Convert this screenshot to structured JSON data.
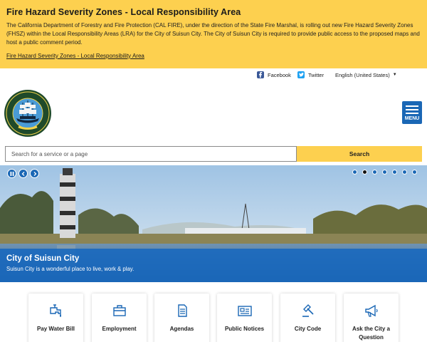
{
  "alert": {
    "title": "Fire Hazard Severity Zones - Local Responsibility Area",
    "body": "The California Department of Forestry and Fire Protection (CAL FIRE), under the direction of the State Fire Marshal, is rolling out new Fire Hazard Severity Zones (FHSZ) within the Local Responsibility Areas (LRA) for the City of Suisun City. The City of Suisun City is required to provide public access to the proposed maps and host a public comment period.",
    "link_label": "Fire Hazard Severity Zones - Local Responsibility Area"
  },
  "utility": {
    "facebook_label": "Facebook",
    "facebook_icon": "facebook-icon",
    "twitter_label": "Twitter",
    "twitter_icon": "twitter-icon",
    "language_label": "English (United States)"
  },
  "header": {
    "logo_text_top": "CITY OF SUISUN CITY",
    "logo_text_bottom": "CALIFORNIA",
    "menu_label": "MENU"
  },
  "search": {
    "placeholder": "Search for a service or a page",
    "button_label": "Search"
  },
  "hero": {
    "title": "City of Suisun City",
    "subtitle": "Suisun City is a wonderful place to live, work & play.",
    "slide_count": 7,
    "active_slide": 2
  },
  "tiles": [
    {
      "label": "Pay Water Bill",
      "icon": "water-faucet-icon"
    },
    {
      "label": "Employment",
      "icon": "briefcase-icon"
    },
    {
      "label": "Agendas",
      "icon": "document-icon"
    },
    {
      "label": "Public Notices",
      "icon": "newspaper-icon"
    },
    {
      "label": "City Code",
      "icon": "gavel-icon"
    },
    {
      "label": "Ask the City a Question",
      "icon": "megaphone-icon"
    }
  ],
  "colors": {
    "alert_bg": "#fdd04f",
    "brand_blue": "#1a67b5",
    "logo_green": "#1f4a2a"
  }
}
